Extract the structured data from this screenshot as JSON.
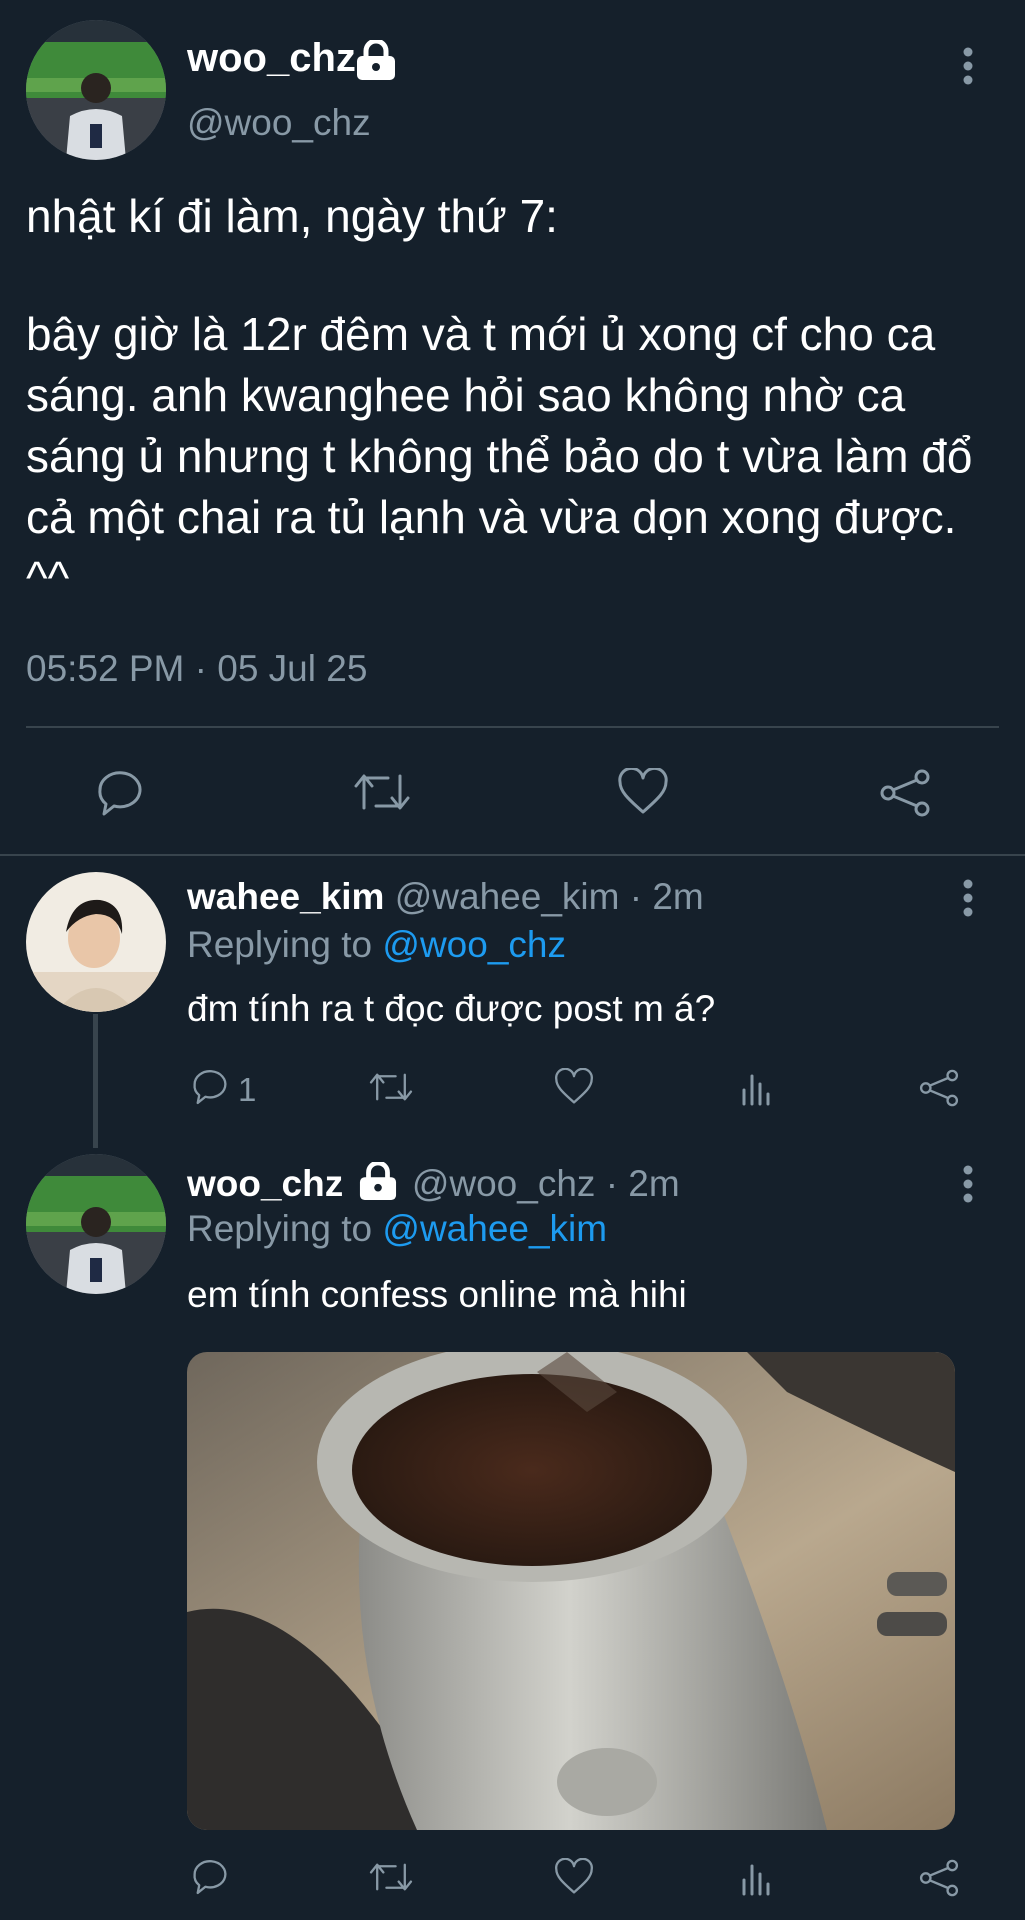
{
  "main_tweet": {
    "display_name": "woo_chz",
    "handle": "@woo_chz",
    "text_line1": "nhật kí đi làm, ngày thứ 7:",
    "text_body": "bây giờ là 12r đêm và t mới ủ xong cf cho ca sáng. anh kwanghee hỏi sao không nhờ ca sáng ủ nhưng t không thể bảo do t vừa làm đổ cả một chai ra tủ lạnh và vừa dọn xong được. ^^",
    "timestamp": "05:52 PM · 05 Jul 25",
    "icons": [
      "lock-icon",
      "more-icon",
      "reply-icon",
      "retweet-icon",
      "like-icon",
      "share-icon"
    ]
  },
  "reply1": {
    "display_name": "wahee_kim",
    "handle": "@wahee_kim",
    "time": "· 2m",
    "replying_prefix": "Replying to",
    "replying_to": "@woo_chz",
    "text": "đm tính ra t đọc được post m á?",
    "reply_count": "1"
  },
  "reply2": {
    "display_name": "woo_chz",
    "handle": "@woo_chz",
    "time": "· 2m",
    "replying_prefix": "Replying to",
    "replying_to": "@wahee_kim",
    "text": "em tính confess online mà hihi"
  },
  "colors": {
    "background": "#15202b",
    "muted": "#8899a6",
    "link": "#1d9bf0",
    "divider": "#38444d"
  }
}
